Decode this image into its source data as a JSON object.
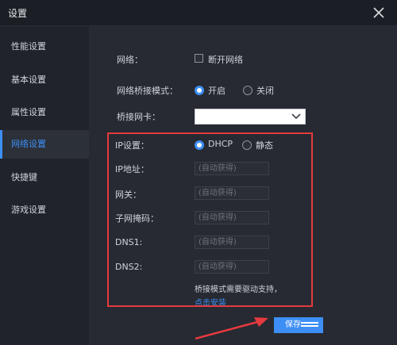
{
  "window": {
    "title": "设置"
  },
  "sidebar": {
    "items": [
      {
        "label": "性能设置"
      },
      {
        "label": "基本设置"
      },
      {
        "label": "属性设置"
      },
      {
        "label": "网络设置"
      },
      {
        "label": "快捷键"
      },
      {
        "label": "游戏设置"
      }
    ],
    "active": "网络设置"
  },
  "network": {
    "network_label": "网络：",
    "disconnect_label": "断开网络",
    "disconnect_checked": false,
    "bridge_mode_label": "网络桥接模式：",
    "bridge_on_label": "开启",
    "bridge_off_label": "关闭",
    "bridge_selected": "开启",
    "bridge_nic_label": "桥接网卡：",
    "bridge_nic_value": "",
    "ip_setting_label": "IP设置：",
    "ip_dhcp_label": "DHCP",
    "ip_static_label": "静态",
    "ip_selected": "DHCP",
    "fields": [
      {
        "label": "IP地址：",
        "placeholder": "(自动获得)"
      },
      {
        "label": "网关：",
        "placeholder": "(自动获得)"
      },
      {
        "label": "子网掩码：",
        "placeholder": "(自动获得)"
      },
      {
        "label": "DNS1:",
        "placeholder": "(自动获得)"
      },
      {
        "label": "DNS2:",
        "placeholder": "(自动获得)"
      }
    ],
    "note": "桥接模式需要驱动支持，",
    "install_link": "点击安装"
  },
  "footer": {
    "save_label": "保存"
  },
  "colors": {
    "accent": "#3d8ff5",
    "highlight_box": "#e33a3d",
    "background": "#272a32"
  }
}
